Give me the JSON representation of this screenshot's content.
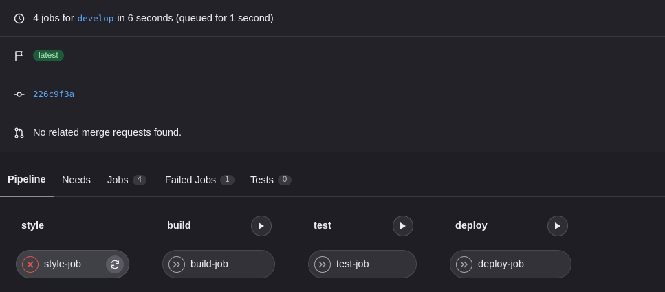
{
  "summary": {
    "jobs_prefix": "4 jobs for",
    "branch": "develop",
    "jobs_suffix": "in 6 seconds (queued for 1 second)",
    "tag": "latest",
    "commit_sha": "226c9f3a",
    "merge_requests": "No related merge requests found."
  },
  "tabs": [
    {
      "label": "Pipeline"
    },
    {
      "label": "Needs"
    },
    {
      "label": "Jobs",
      "count": "4"
    },
    {
      "label": "Failed Jobs",
      "count": "1"
    },
    {
      "label": "Tests",
      "count": "0"
    }
  ],
  "stages": [
    {
      "name": "style",
      "job": "style-job",
      "status": "failed"
    },
    {
      "name": "build",
      "job": "build-job",
      "status": "skipped"
    },
    {
      "name": "test",
      "job": "test-job",
      "status": "skipped"
    },
    {
      "name": "deploy",
      "job": "deploy-job",
      "status": "skipped"
    }
  ],
  "colors": {
    "link": "#5aa4f0",
    "badge_bg": "#1e5b38",
    "failed": "#e5534b"
  },
  "icons": [
    "clock-icon",
    "flag-icon",
    "commit-icon",
    "merge-request-icon",
    "play-icon",
    "status-failed-icon",
    "status-skipped-icon",
    "retry-icon"
  ]
}
